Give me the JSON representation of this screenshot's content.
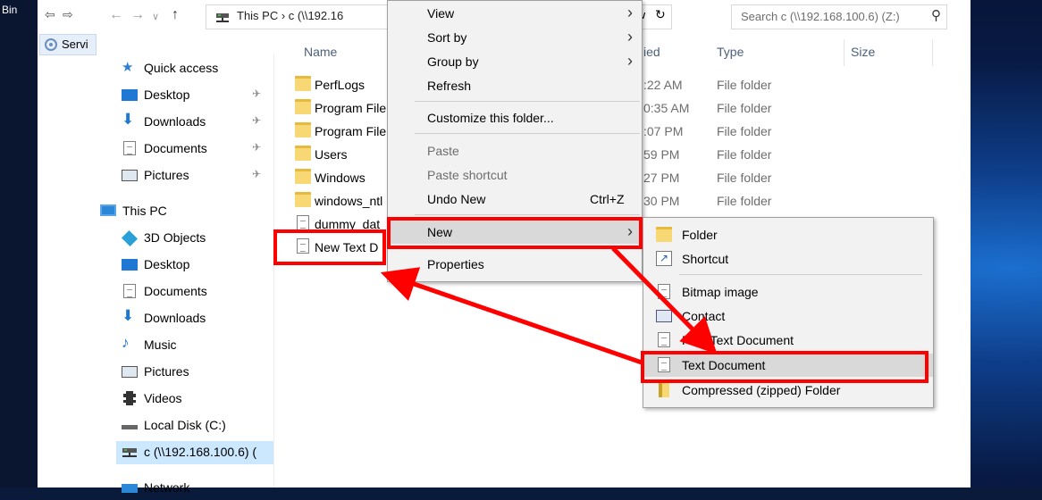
{
  "desktop": {
    "bin_label": "Bin"
  },
  "toolbar": {
    "address_path": "This PC  ›  c (\\\\192.16",
    "search_placeholder": "Search c (\\\\192.168.100.6) (Z:)",
    "left_tab": "Servi"
  },
  "nav": {
    "quick_access": "Quick access",
    "items": [
      {
        "label": "Desktop"
      },
      {
        "label": "Downloads"
      },
      {
        "label": "Documents"
      },
      {
        "label": "Pictures"
      },
      {
        "label": "This PC"
      },
      {
        "label": "3D Objects"
      },
      {
        "label": "Desktop"
      },
      {
        "label": "Documents"
      },
      {
        "label": "Downloads"
      },
      {
        "label": "Music"
      },
      {
        "label": "Pictures"
      },
      {
        "label": "Videos"
      },
      {
        "label": "Local Disk (C:)"
      },
      {
        "label": "c (\\\\192.168.100.6) ("
      },
      {
        "label": "Network"
      }
    ]
  },
  "columns": {
    "name": "Name",
    "modified": "ied",
    "type": "Type",
    "size": "Size"
  },
  "files": [
    {
      "name": "PerfLogs",
      "date": ":22 AM",
      "type": "File folder"
    },
    {
      "name": "Program File",
      "date": "0:35 AM",
      "type": "File folder"
    },
    {
      "name": "Program File",
      "date": ":07 PM",
      "type": "File folder"
    },
    {
      "name": "Users",
      "date": "59 PM",
      "type": "File folder"
    },
    {
      "name": "Windows",
      "date": "27 PM",
      "type": "File folder"
    },
    {
      "name": "windows_ntl",
      "date": "30 PM",
      "type": "File folder"
    },
    {
      "name": "dummy_dat",
      "date": "",
      "type": ""
    },
    {
      "name": "New Text D",
      "date": "",
      "type": ""
    }
  ],
  "context_menu": {
    "view": "View",
    "sort_by": "Sort by",
    "group_by": "Group by",
    "refresh": "Refresh",
    "customize": "Customize this folder...",
    "paste": "Paste",
    "paste_shortcut": "Paste shortcut",
    "undo_new": "Undo New",
    "undo_shortcut": "Ctrl+Z",
    "new": "New",
    "properties": "Properties"
  },
  "submenu": {
    "folder": "Folder",
    "shortcut": "Shortcut",
    "bitmap": "Bitmap image",
    "contact": "Contact",
    "rtf": "Rich Text Document",
    "text": "Text Document",
    "zip": "Compressed (zipped) Folder"
  },
  "colors": {
    "highlight": "#ff0000",
    "menu_bg": "#f2f2f2",
    "selection": "#cce8ff"
  }
}
